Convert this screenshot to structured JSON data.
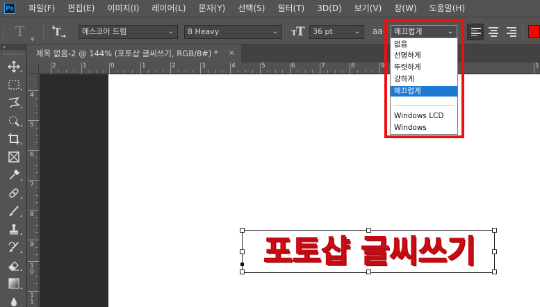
{
  "app": {
    "logo": "Ps"
  },
  "menu": [
    "파일(F)",
    "편집(E)",
    "이미지(I)",
    "레이어(L)",
    "문자(Y)",
    "선택(S)",
    "필터(T)",
    "3D(D)",
    "보기(V)",
    "창(W)",
    "도움말(H)"
  ],
  "options": {
    "font_family": "에스코어 드림",
    "font_style": "8 Heavy",
    "font_size": "36 pt",
    "aa_label": "aa",
    "antialias_value": "매끄럽게",
    "antialias_options": [
      "없음",
      "선명하게",
      "뚜렷하게",
      "강하게",
      "매끄럽게",
      "Windows LCD",
      "Windows"
    ],
    "selected_option": "매끄럽게",
    "text_color": "#ff0000",
    "highlight_color": "#ee0f0f"
  },
  "document": {
    "tab_title": "제목 없음-2 @ 144% (포토샵 글씨쓰기, RGB/8#) *",
    "close": "×",
    "text_layer": "포토샵 글씨쓰기"
  },
  "rulers": {
    "h": [
      "2",
      "1",
      "0",
      "1",
      "2",
      "3",
      "4",
      "5",
      "6",
      "7",
      "8",
      "9",
      "1"
    ],
    "v": [
      "4",
      "5",
      "6",
      "7",
      "8",
      "9",
      "1\n0",
      "1\n1"
    ]
  }
}
